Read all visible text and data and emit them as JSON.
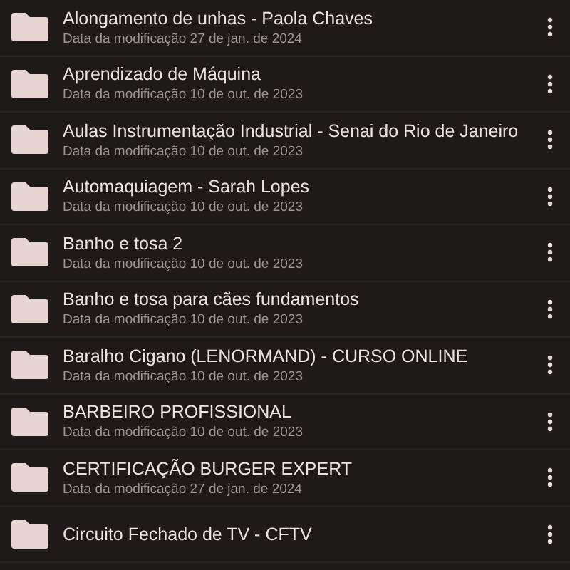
{
  "folders": [
    {
      "name": "Alongamento de unhas - Paola Chaves",
      "modified": "Data da modificação 27 de jan. de 2024"
    },
    {
      "name": "Aprendizado de Máquina",
      "modified": "Data da modificação 10 de out. de 2023"
    },
    {
      "name": "Aulas Instrumentação Industrial - Senai do Rio de Janeiro",
      "modified": "Data da modificação 10 de out. de 2023"
    },
    {
      "name": "Automaquiagem - Sarah Lopes",
      "modified": "Data da modificação 10 de out. de 2023"
    },
    {
      "name": "Banho e tosa 2",
      "modified": "Data da modificação 10 de out. de 2023"
    },
    {
      "name": "Banho e tosa para cães fundamentos",
      "modified": "Data da modificação 10 de out. de 2023"
    },
    {
      "name": "Baralho Cigano (LENORMAND) - CURSO ONLINE",
      "modified": "Data da modificação 10 de out. de 2023"
    },
    {
      "name": "BARBEIRO PROFISSIONAL",
      "modified": "Data da modificação 10 de out. de 2023"
    },
    {
      "name": "CERTIFICAÇÃO BURGER EXPERT",
      "modified": "Data da modificação 27 de jan. de 2024"
    },
    {
      "name": "Circuito Fechado de TV - CFTV"
    }
  ]
}
